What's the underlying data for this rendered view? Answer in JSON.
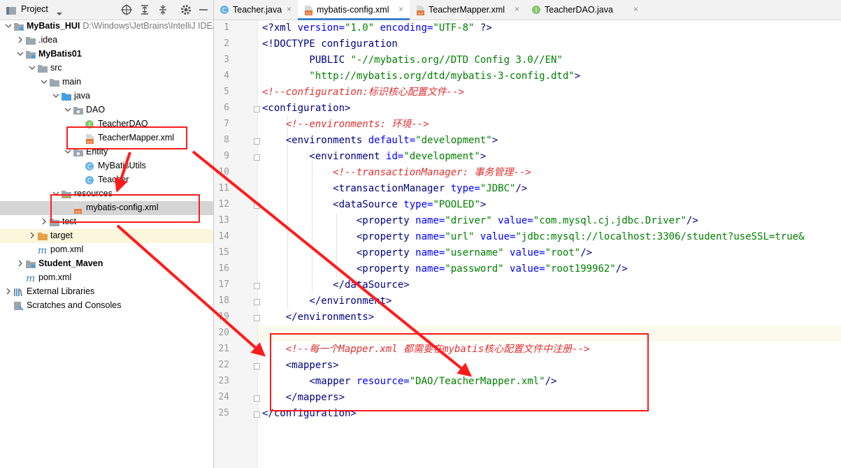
{
  "project_panel": {
    "title": "Project",
    "tree": [
      {
        "label": "MyBatis_HUI",
        "path": "D:\\Windows\\JetBrains\\IntelliJ IDEA",
        "icon": "module-folder-icon",
        "arrow": "down",
        "indent": 0,
        "bold": true
      },
      {
        "label": ".idea",
        "icon": "folder-icon",
        "arrow": "right",
        "indent": 1
      },
      {
        "label": "MyBatis01",
        "icon": "module-folder-icon",
        "arrow": "down",
        "indent": 1,
        "bold": true
      },
      {
        "label": "src",
        "icon": "folder-icon",
        "arrow": "down",
        "indent": 2
      },
      {
        "label": "main",
        "icon": "folder-icon",
        "arrow": "down",
        "indent": 3
      },
      {
        "label": "java",
        "icon": "source-folder-icon",
        "arrow": "down",
        "indent": 4
      },
      {
        "label": "DAO",
        "icon": "package-icon",
        "arrow": "down",
        "indent": 5
      },
      {
        "label": "TeacherDAO",
        "icon": "interface-icon",
        "arrow": "",
        "indent": 6
      },
      {
        "label": "TeacherMapper.xml",
        "icon": "xml-file-icon",
        "arrow": "",
        "indent": 6
      },
      {
        "label": "Entity",
        "icon": "package-icon",
        "arrow": "down",
        "indent": 5
      },
      {
        "label": "MyBatisUtils",
        "icon": "class-icon",
        "arrow": "",
        "indent": 6
      },
      {
        "label": "Teacher",
        "icon": "class-icon",
        "arrow": "",
        "indent": 6
      },
      {
        "label": "resources",
        "icon": "resources-folder-icon",
        "arrow": "down",
        "indent": 4
      },
      {
        "label": "mybatis-config.xml",
        "icon": "xml-file-icon",
        "arrow": "",
        "indent": 5,
        "selected": true
      },
      {
        "label": "test",
        "icon": "folder-icon",
        "arrow": "right",
        "indent": 3
      },
      {
        "label": "target",
        "icon": "target-folder-icon",
        "arrow": "right",
        "indent": 2,
        "highlighted": true
      },
      {
        "label": "pom.xml",
        "icon": "maven-icon",
        "arrow": "",
        "indent": 2
      },
      {
        "label": "Student_Maven",
        "icon": "module-folder-icon",
        "arrow": "right",
        "indent": 1,
        "bold": true
      },
      {
        "label": "pom.xml",
        "icon": "maven-icon",
        "arrow": "",
        "indent": 1
      },
      {
        "label": "External Libraries",
        "icon": "libraries-icon",
        "arrow": "right",
        "indent": 0
      },
      {
        "label": "Scratches and Consoles",
        "icon": "scratches-icon",
        "arrow": "",
        "indent": 0
      }
    ]
  },
  "tabs": [
    {
      "label": "Teacher.java",
      "icon": "class-icon"
    },
    {
      "label": "mybatis-config.xml",
      "icon": "xml-file-icon",
      "active": true
    },
    {
      "label": "TeacherMapper.xml",
      "icon": "xml-file-icon"
    },
    {
      "label": "TeacherDAO.java",
      "icon": "interface-icon"
    }
  ],
  "tab_close_glyph": "×",
  "editor": {
    "lines": [
      [
        [
          "tg",
          "<?xml "
        ],
        [
          "an",
          "version="
        ],
        [
          "av",
          "\"1.0\""
        ],
        [
          "an",
          " encoding="
        ],
        [
          "av",
          "\"UTF-8\""
        ],
        [
          "tg",
          " ?>"
        ]
      ],
      [
        [
          "tg",
          "<!DOCTYPE configuration"
        ]
      ],
      [
        [
          "tg",
          "        PUBLIC "
        ],
        [
          "av",
          "\"-//mybatis.org//DTD Config 3.0//EN\""
        ]
      ],
      [
        [
          "av",
          "        \"http://mybatis.org/dtd/mybatis-3-config.dtd\""
        ],
        [
          "tg",
          ">"
        ]
      ],
      [
        [
          "cm",
          "<!--configuration:标识核心配置文件-->"
        ]
      ],
      [
        [
          "tg",
          "<configuration>"
        ]
      ],
      [
        [
          "cm",
          "    <!--environments: 环境-->"
        ]
      ],
      [
        [
          "tg",
          "    <environments "
        ],
        [
          "an",
          "default="
        ],
        [
          "av",
          "\"development\""
        ],
        [
          "tg",
          ">"
        ]
      ],
      [
        [
          "tg",
          "        <environment "
        ],
        [
          "an",
          "id="
        ],
        [
          "av",
          "\"development\""
        ],
        [
          "tg",
          ">"
        ]
      ],
      [
        [
          "cm",
          "            <!--transactionManager: 事务管理-->"
        ]
      ],
      [
        [
          "tg",
          "            <transactionManager "
        ],
        [
          "an",
          "type="
        ],
        [
          "av",
          "\"JDBC\""
        ],
        [
          "tg",
          "/>"
        ]
      ],
      [
        [
          "tg",
          "            <dataSource "
        ],
        [
          "an",
          "type="
        ],
        [
          "av",
          "\"POOLED\""
        ],
        [
          "tg",
          ">"
        ]
      ],
      [
        [
          "tg",
          "                <property "
        ],
        [
          "an",
          "name="
        ],
        [
          "av",
          "\"driver\""
        ],
        [
          "an",
          " value="
        ],
        [
          "av",
          "\"com.mysql.cj.jdbc.Driver\""
        ],
        [
          "tg",
          "/>"
        ]
      ],
      [
        [
          "tg",
          "                <property "
        ],
        [
          "an",
          "name="
        ],
        [
          "av",
          "\"url\""
        ],
        [
          "an",
          " value="
        ],
        [
          "av",
          "\"jdbc:mysql://localhost:3306/student?useSSL=true&"
        ]
      ],
      [
        [
          "tg",
          "                <property "
        ],
        [
          "an",
          "name="
        ],
        [
          "av",
          "\"username\""
        ],
        [
          "an",
          " value="
        ],
        [
          "av",
          "\"root\""
        ],
        [
          "tg",
          "/>"
        ]
      ],
      [
        [
          "tg",
          "                <property "
        ],
        [
          "an",
          "name="
        ],
        [
          "av",
          "\"password\""
        ],
        [
          "an",
          " value="
        ],
        [
          "av",
          "\"root199962\""
        ],
        [
          "tg",
          "/>"
        ]
      ],
      [
        [
          "tg",
          "            </dataSource>"
        ]
      ],
      [
        [
          "tg",
          "        </environment>"
        ]
      ],
      [
        [
          "tg",
          "    </environments>"
        ]
      ],
      [],
      [
        [
          "cm",
          "    <!--每一个Mapper.xml 都需要在mybatis核心配置文件中注册-->"
        ]
      ],
      [
        [
          "tg",
          "    <mappers>"
        ]
      ],
      [
        [
          "tg",
          "        <mapper "
        ],
        [
          "an",
          "resource="
        ],
        [
          "av",
          "\"DAO/TeacherMapper.xml\""
        ],
        [
          "tg",
          "/>"
        ]
      ],
      [
        [
          "tg",
          "    </mappers>"
        ]
      ],
      [
        [
          "tg",
          "</configuration>"
        ]
      ]
    ]
  },
  "colors": {
    "tag": "#000080",
    "attr_name": "#0000ff",
    "attr_value": "#008000",
    "comment": "#e03030",
    "annotation_red": "#ff1b1b",
    "tab_active_underline": "#4083c9"
  }
}
